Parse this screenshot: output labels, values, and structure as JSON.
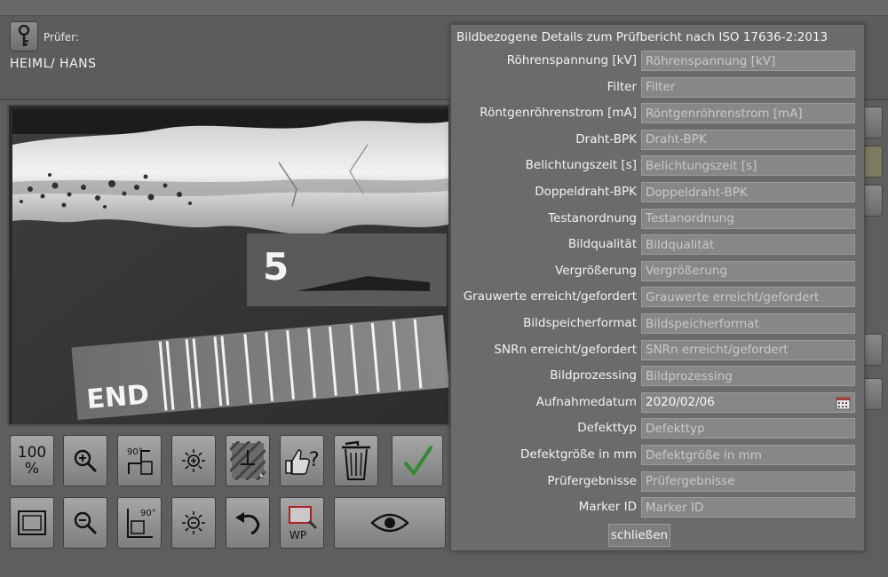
{
  "header": {
    "pruefer_label": "Prüfer:",
    "pruefer_name": "HEIML/ HANS"
  },
  "dialog": {
    "title": "Bildbezogene Details zum Prüfbericht nach ISO 17636-2:2013",
    "fields": [
      {
        "label": "Röhrenspannung [kV]",
        "placeholder": "Röhrenspannung [kV]",
        "value": ""
      },
      {
        "label": "Filter",
        "placeholder": "Filter",
        "value": ""
      },
      {
        "label": "Röntgenröhrenstrom [mA]",
        "placeholder": "Röntgenröhrenstrom [mA]",
        "value": ""
      },
      {
        "label": "Draht-BPK",
        "placeholder": "Draht-BPK",
        "value": ""
      },
      {
        "label": "Belichtungszeit [s]",
        "placeholder": "Belichtungszeit [s]",
        "value": ""
      },
      {
        "label": "Doppeldraht-BPK",
        "placeholder": "Doppeldraht-BPK",
        "value": ""
      },
      {
        "label": "Testanordnung",
        "placeholder": "Testanordnung",
        "value": ""
      },
      {
        "label": "Bildqualität",
        "placeholder": "Bildqualität",
        "value": ""
      },
      {
        "label": "Vergrößerung",
        "placeholder": "Vergrößerung",
        "value": ""
      },
      {
        "label": "Grauwerte erreicht/gefordert",
        "placeholder": "Grauwerte erreicht/gefordert",
        "value": ""
      },
      {
        "label": "Bildspeicherformat",
        "placeholder": "Bildspeicherformat",
        "value": ""
      },
      {
        "label": "SNRn erreicht/gefordert",
        "placeholder": "SNRn erreicht/gefordert",
        "value": ""
      },
      {
        "label": "Bildprozessing",
        "placeholder": "Bildprozessing",
        "value": ""
      },
      {
        "label": "Aufnahmedatum",
        "placeholder": "",
        "value": "2020/02/06"
      },
      {
        "label": "Defekttyp",
        "placeholder": "Defekttyp",
        "value": ""
      },
      {
        "label": "Defektgröße in mm",
        "placeholder": "Defektgröße in mm",
        "value": ""
      },
      {
        "label": "Prüfergebnisse",
        "placeholder": "Prüfergebnisse",
        "value": ""
      },
      {
        "label": "Marker ID",
        "placeholder": "Marker ID",
        "value": ""
      }
    ],
    "close_label": "schließen"
  },
  "xray": {
    "marker_number": "5",
    "marker_end": "END"
  },
  "toolbar": {
    "zoom_100_label": "100\n%",
    "rotate_90_label": "90°",
    "rotate_minus_90_label": "90°",
    "quality_label": "?",
    "wp_label": "WP"
  },
  "icons": {
    "key": "key-icon",
    "zoom_in": "zoom-in-icon",
    "zoom_out": "zoom-out-icon",
    "brightness_up": "brightness-up-icon",
    "brightness_down": "brightness-down-icon",
    "profile": "line-profile-icon",
    "undo": "undo-icon",
    "delete": "trash-icon",
    "confirm": "checkmark-icon",
    "fit": "fit-screen-icon",
    "eye": "eye-icon",
    "calendar": "calendar-icon"
  },
  "colors": {
    "confirm_green": "#2e8b2e",
    "placeholder": "#c9c9c9",
    "background": "#5e5e5e",
    "dialog": "#6b6b6b"
  }
}
